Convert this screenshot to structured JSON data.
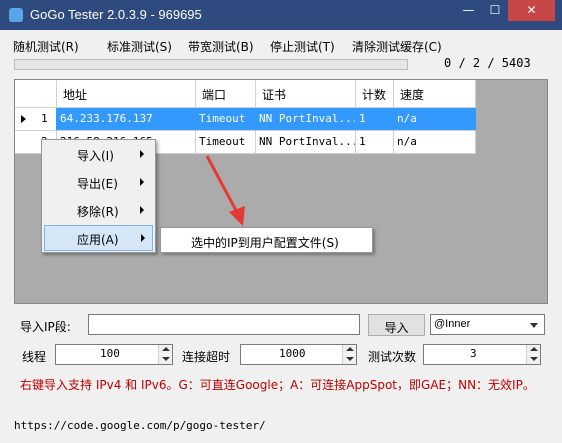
{
  "window": {
    "title": "GoGo Tester 2.0.3.9 - 969695",
    "minimize": "—",
    "maximize": "☐",
    "close": "✕"
  },
  "menu": [
    "随机测试(R)",
    "标准测试(S)",
    "带宽测试(B)",
    "停止测试(T)",
    "清除测试缓存(C)"
  ],
  "progress": {
    "text": "0 / 2 / 5403",
    "fraction": 0.0
  },
  "grid": {
    "columns": [
      "地址",
      "端口",
      "证书",
      "计数",
      "速度"
    ],
    "rows": [
      {
        "num": "1",
        "address": "64.233.176.137",
        "port": "Timeout",
        "cert": "NN PortInval...",
        "count": "1",
        "speed": "n/a",
        "selected": true
      },
      {
        "num": "2",
        "address": "216.58.216.165",
        "port": "Timeout",
        "cert": "NN PortInval...",
        "count": "1",
        "speed": "n/a",
        "selected": false
      }
    ]
  },
  "context_menu": {
    "items": [
      "导入(I)",
      "导出(E)",
      "移除(R)",
      "应用(A)"
    ],
    "submenu": "选中的IP到用户配置文件(S)"
  },
  "import": {
    "label": "导入IP段:",
    "value": "",
    "button": "导入",
    "select": "@Inner"
  },
  "settings": {
    "threads_label": "线程",
    "threads": "100",
    "timeout_label": "连接超时",
    "timeout": "1000",
    "tests_label": "测试次数",
    "tests": "3"
  },
  "hint": "右键导入支持 IPv4 和 IPv6。G：可直连Google；A：可连接AppSpot，即GAE；NN：无效IP。",
  "url": "https://code.google.com/p/gogo-tester/",
  "colors": {
    "titlebar": "#2e4a7e",
    "progress": "#06b025",
    "selection": "#3399ff",
    "hint": "#c00000"
  }
}
